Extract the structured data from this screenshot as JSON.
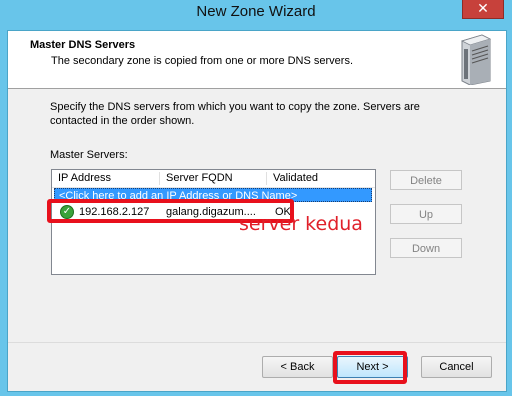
{
  "window": {
    "title": "New Zone Wizard",
    "close_glyph": "✕"
  },
  "header": {
    "title": "Master DNS Servers",
    "subtitle": "The secondary zone is copied from one or more DNS servers.",
    "icon": "server-icon"
  },
  "body": {
    "instructions": "Specify the DNS servers from which you want to copy the zone.  Servers are contacted in the order shown.",
    "master_label": "Master Servers:"
  },
  "list": {
    "columns": [
      "IP Address",
      "Server FQDN",
      "Validated"
    ],
    "add_row": "<Click here to add an IP Address or DNS Name>",
    "rows": [
      {
        "ip": "192.168.2.127",
        "fqdn": "galang.digazum....",
        "validated": "OK",
        "status_icon": "check-icon"
      }
    ]
  },
  "side_buttons": {
    "delete": "Delete",
    "up": "Up",
    "down": "Down"
  },
  "annotation": "server kedua",
  "footer": {
    "back": "< Back",
    "next": "Next >",
    "cancel": "Cancel"
  },
  "colors": {
    "highlight": "#e8101c",
    "selection": "#3399ff",
    "titlebar": "#68c5ea"
  }
}
